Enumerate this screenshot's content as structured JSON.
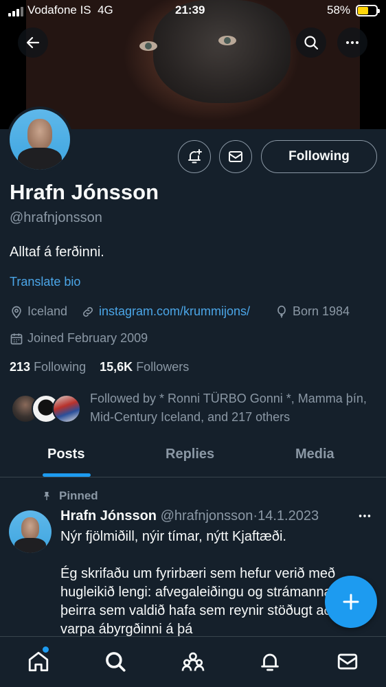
{
  "status_bar": {
    "carrier": "Vodafone IS",
    "network": "4G",
    "time": "21:39",
    "battery_percent": "58%",
    "battery_level": 0.58
  },
  "profile": {
    "name": "Hrafn Jónsson",
    "handle": "@hrafnjonsson",
    "bio": "Alltaf á ferðinni.",
    "translate_label": "Translate bio",
    "location": "Iceland",
    "website": "instagram.com/krummijons/",
    "birth": "Born 1984",
    "joined": "Joined February 2009",
    "following_count": "213",
    "following_label": "Following",
    "followers_count": "15,6K",
    "followers_label": "Followers",
    "followed_by": "Followed by * Ronni TÜRBO Gonni *, Mamma þín, Mid-Century Iceland, and 217 others",
    "follow_button": "Following"
  },
  "tabs": [
    {
      "label": "Posts",
      "active": true
    },
    {
      "label": "Replies",
      "active": false
    },
    {
      "label": "Media",
      "active": false
    }
  ],
  "pinned_tweet": {
    "pinned_label": "Pinned",
    "author_name": "Hrafn Jónsson",
    "author_handle": "@hrafnjonsson",
    "separator": "·",
    "date": "14.1.2023",
    "text_line1": "Nýr fjölmiðill, nýir tímar, nýtt Kjaftæði.",
    "text_rest": "Ég skrifaðu um fyrirbæri sem hefur verið með hugleikið lengi: afvegaleiðingu og strámannagerð þeirra sem valdið hafa sem reynir stöðugt að varpa ábyrgðinni á þá"
  },
  "nav": {
    "items": [
      "home-icon",
      "search-icon",
      "communities-icon",
      "notifications-icon",
      "messages-icon"
    ],
    "home_has_dot": true
  },
  "colors": {
    "background": "#15202b",
    "accent": "#1d9bf0",
    "link": "#4ba6e8",
    "muted": "#8b98a5",
    "border": "#38444d"
  }
}
